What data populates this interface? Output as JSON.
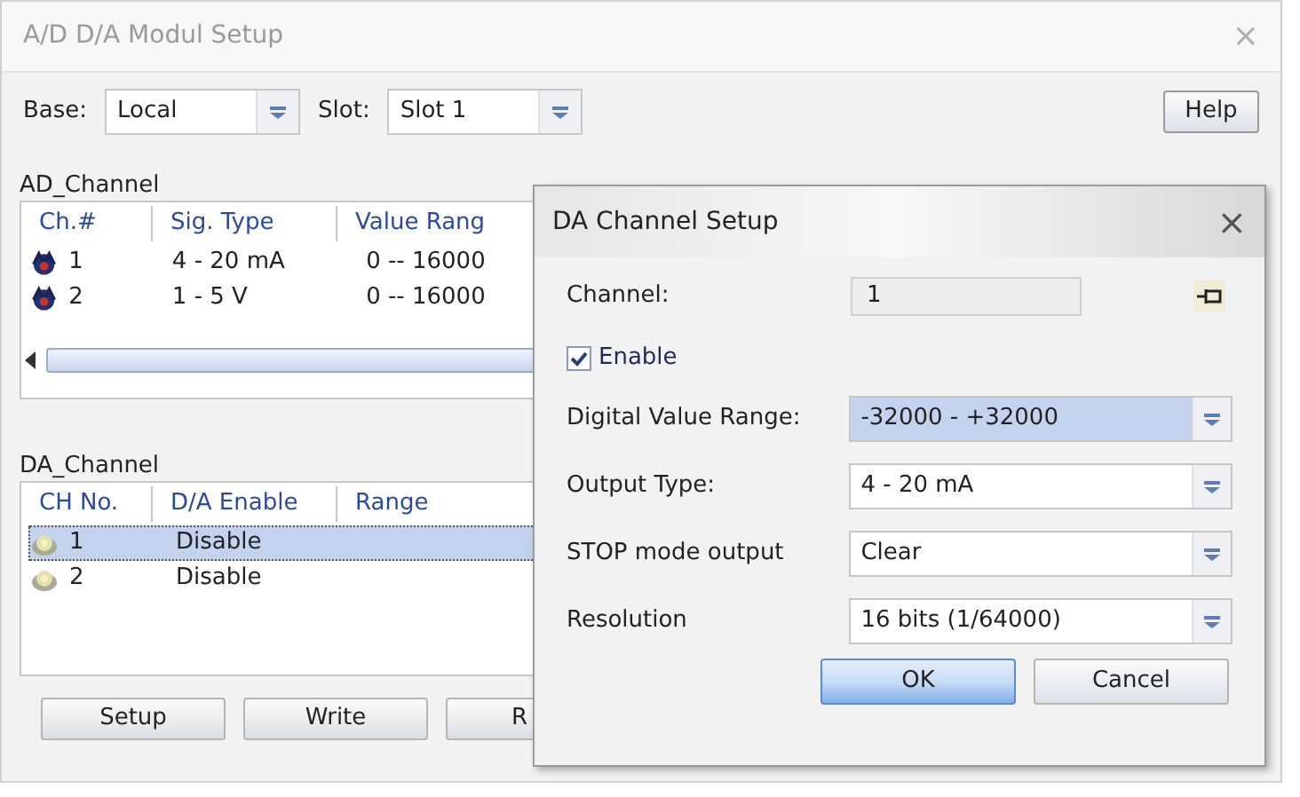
{
  "window": {
    "title": "A/D D/A Modul Setup",
    "close": "×"
  },
  "base": {
    "label": "Base:",
    "value": "Local"
  },
  "slot": {
    "label": "Slot:",
    "value": "Slot 1"
  },
  "help_button": "Help",
  "ad_channel": {
    "label": "AD_Channel",
    "columns": [
      "Ch.#",
      "Sig. Type",
      "Value Rang"
    ],
    "rows": [
      {
        "cells": [
          "1",
          "4 - 20 mA",
          "0 -- 16000"
        ],
        "selected": false
      },
      {
        "cells": [
          "2",
          "1 - 5 V",
          "0 -- 16000"
        ],
        "selected": false
      }
    ]
  },
  "da_channel": {
    "label": "DA_Channel",
    "columns": [
      "CH No.",
      "D/A Enable",
      "Range"
    ],
    "rows": [
      {
        "cells": [
          "1",
          "Disable"
        ],
        "selected": true
      },
      {
        "cells": [
          "2",
          "Disable"
        ],
        "selected": false
      }
    ]
  },
  "buttons": [
    "Setup",
    "Write",
    "R"
  ],
  "dialog": {
    "title": "DA Channel Setup",
    "close": "×",
    "channel": {
      "label": "Channel:",
      "value": "1"
    },
    "enable": {
      "label": "Enable",
      "checked": true
    },
    "combos": [
      {
        "label": "Digital Value Range:",
        "value": "-32000 - +32000",
        "highlighted": true
      },
      {
        "label": "Output Type:",
        "value": "4 - 20 mA",
        "highlighted": false
      },
      {
        "label": "STOP mode output",
        "value": "Clear",
        "highlighted": false
      },
      {
        "label": "Resolution",
        "value": "16 bits (1/64000)",
        "highlighted": false
      }
    ],
    "buttons": [
      {
        "label": "OK",
        "default": true
      },
      {
        "label": "Cancel",
        "default": false
      }
    ]
  }
}
